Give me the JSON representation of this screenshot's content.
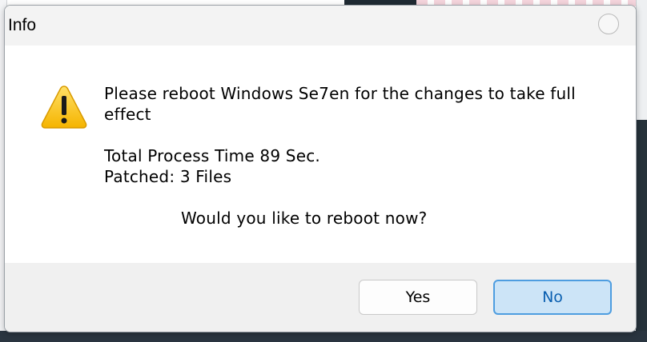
{
  "dialog": {
    "title": "Info",
    "close_icon": "close-circle-icon",
    "icon": "warning-icon",
    "lines": [
      "Please reboot Windows Se7en for the changes to take full",
      "effect",
      "Total Process Time 89 Sec.",
      "Patched: 3 Files",
      "Would you like to reboot now?"
    ],
    "buttons": {
      "yes": "Yes",
      "no": "No"
    }
  },
  "colors": {
    "primary_button_bg": "#cce4f7",
    "primary_button_border": "#4e9de0",
    "warning_yellow": "#ffc927"
  }
}
